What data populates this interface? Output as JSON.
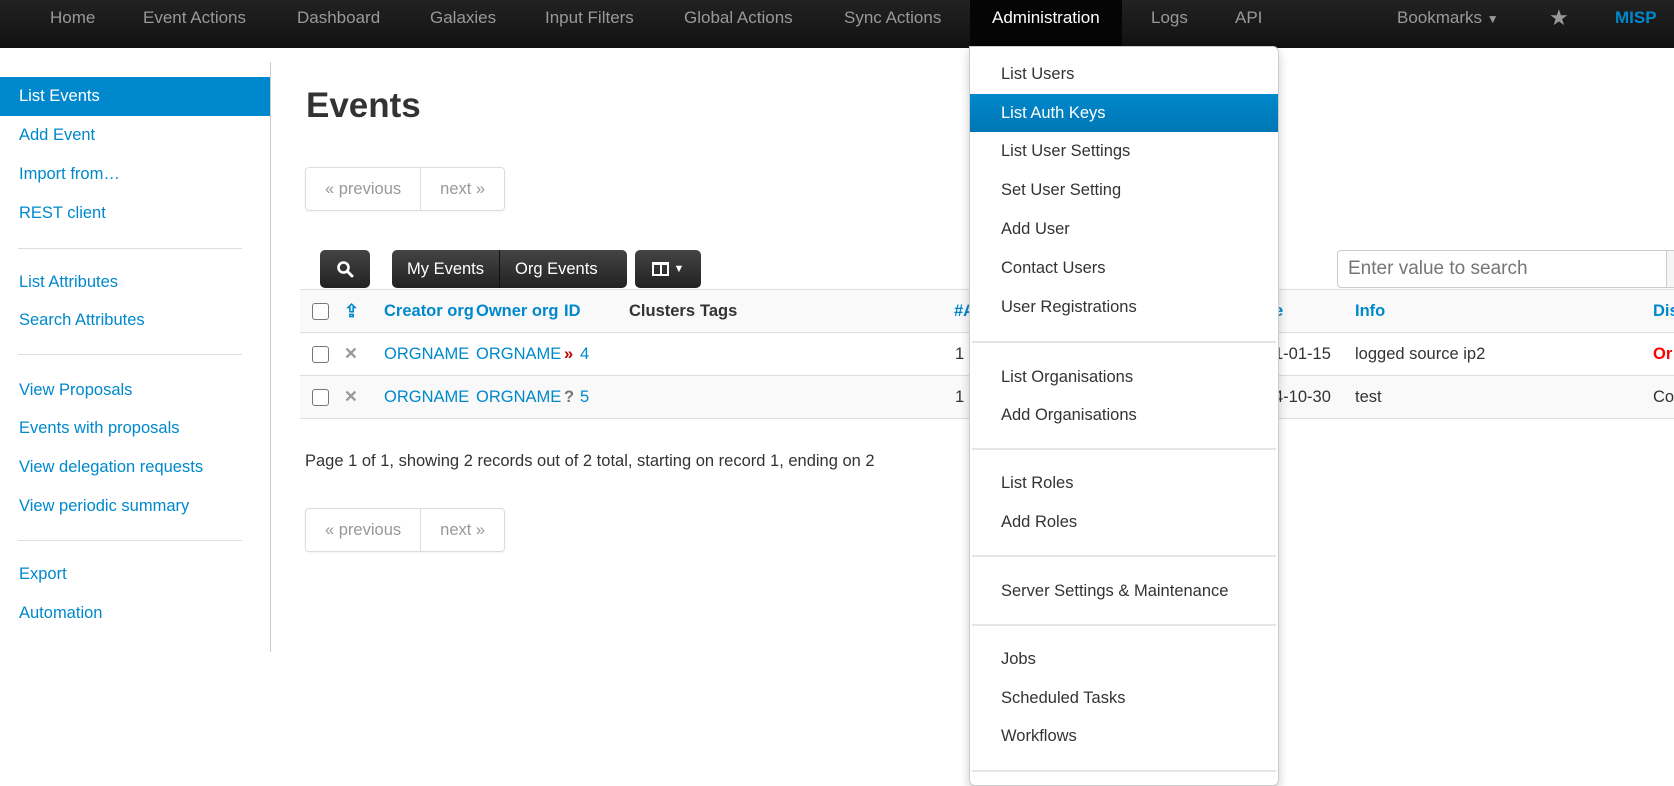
{
  "navbar": {
    "items": [
      "Home",
      "Event Actions",
      "Dashboard",
      "Galaxies",
      "Input Filters",
      "Global Actions",
      "Sync Actions",
      "Administration",
      "Logs",
      "API"
    ],
    "active": "Administration",
    "bookmarks": "Bookmarks",
    "brand": "MISP",
    "brand_color": "#0088cc"
  },
  "sidebar": {
    "groups": [
      [
        "List Events",
        "Add Event",
        "Import from…",
        "REST client"
      ],
      [
        "List Attributes",
        "Search Attributes"
      ],
      [
        "View Proposals",
        "Events with proposals",
        "View delegation requests",
        "View periodic summary"
      ],
      [
        "Export",
        "Automation"
      ]
    ],
    "active": "List Events"
  },
  "main": {
    "title": "Events",
    "pager": {
      "previous": "« previous",
      "next": "next »"
    },
    "toolbar": {
      "my_events": "My Events",
      "org_events": "Org Events"
    },
    "search": {
      "placeholder": "Enter value to search"
    },
    "columns": {
      "creator": "Creator org",
      "owner": "Owner org",
      "id": "ID",
      "clusters": "Clusters",
      "tags": "Tags",
      "attr": "#A",
      "date": "e",
      "info": "Info",
      "dist": "Dis"
    },
    "rows": [
      {
        "creator": "ORGNAME",
        "owner": "ORGNAME",
        "id": "4",
        "id_icon": "threat-level-high",
        "attr": "1",
        "date": "1-01-15",
        "info": "logged source ip2",
        "dist": "Or",
        "dist_color": "#ff0000"
      },
      {
        "creator": "ORGNAME",
        "owner": "ORGNAME",
        "id": "5",
        "id_icon": "threat-level-undefined",
        "attr": "1",
        "date": "4-10-30",
        "info": "test",
        "dist": "Co",
        "dist_color": "#333333"
      }
    ],
    "summary": "Page 1 of 1, showing 2 records out of 2 total, starting on record 1, ending on 2"
  },
  "admin_menu": {
    "groups": [
      [
        "List Users",
        "List Auth Keys",
        "List User Settings",
        "Set User Setting",
        "Add User",
        "Contact Users",
        "User Registrations"
      ],
      [
        "List Organisations",
        "Add Organisations"
      ],
      [
        "List Roles",
        "Add Roles"
      ],
      [
        "Server Settings & Maintenance"
      ],
      [
        "Jobs",
        "Scheduled Tasks",
        "Workflows"
      ]
    ],
    "highlighted": "List Auth Keys"
  }
}
